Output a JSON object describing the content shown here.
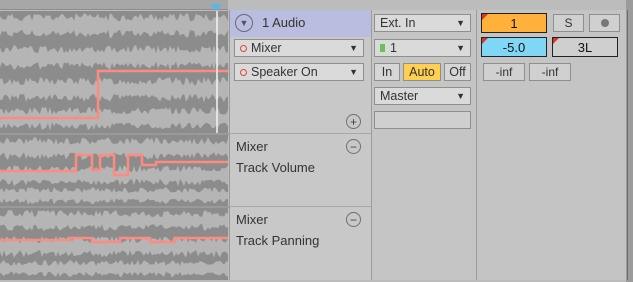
{
  "track": {
    "name": "1 Audio",
    "fold_icon": "chevron-down-icon"
  },
  "lanes": [
    {
      "device": "Mixer",
      "parameter": "Speaker On",
      "automation_color": "#ff8a80"
    },
    {
      "device": "Mixer",
      "parameter": "Track Volume",
      "automation_color": "#ff8a80"
    },
    {
      "device": "Mixer",
      "parameter": "Track Panning",
      "automation_color": "#ff8a80"
    }
  ],
  "io": {
    "input_type": "Ext. In",
    "input_channel": "1",
    "monitor": {
      "in": "In",
      "auto": "Auto",
      "off": "Off",
      "active": "Auto"
    },
    "output": "Master"
  },
  "mixer": {
    "track_number": "1",
    "volume": "-5.0",
    "pan": "3L",
    "solo": "S",
    "arm_icon": "record-dot-icon",
    "send_a": "-inf",
    "send_b": "-inf"
  },
  "colors": {
    "track_accent": "#ffb13b",
    "volume_box": "#7fd7f5",
    "title_bar": "#b9bddf",
    "automation": "#ff8a80",
    "playhead": "#5ab6e8"
  }
}
